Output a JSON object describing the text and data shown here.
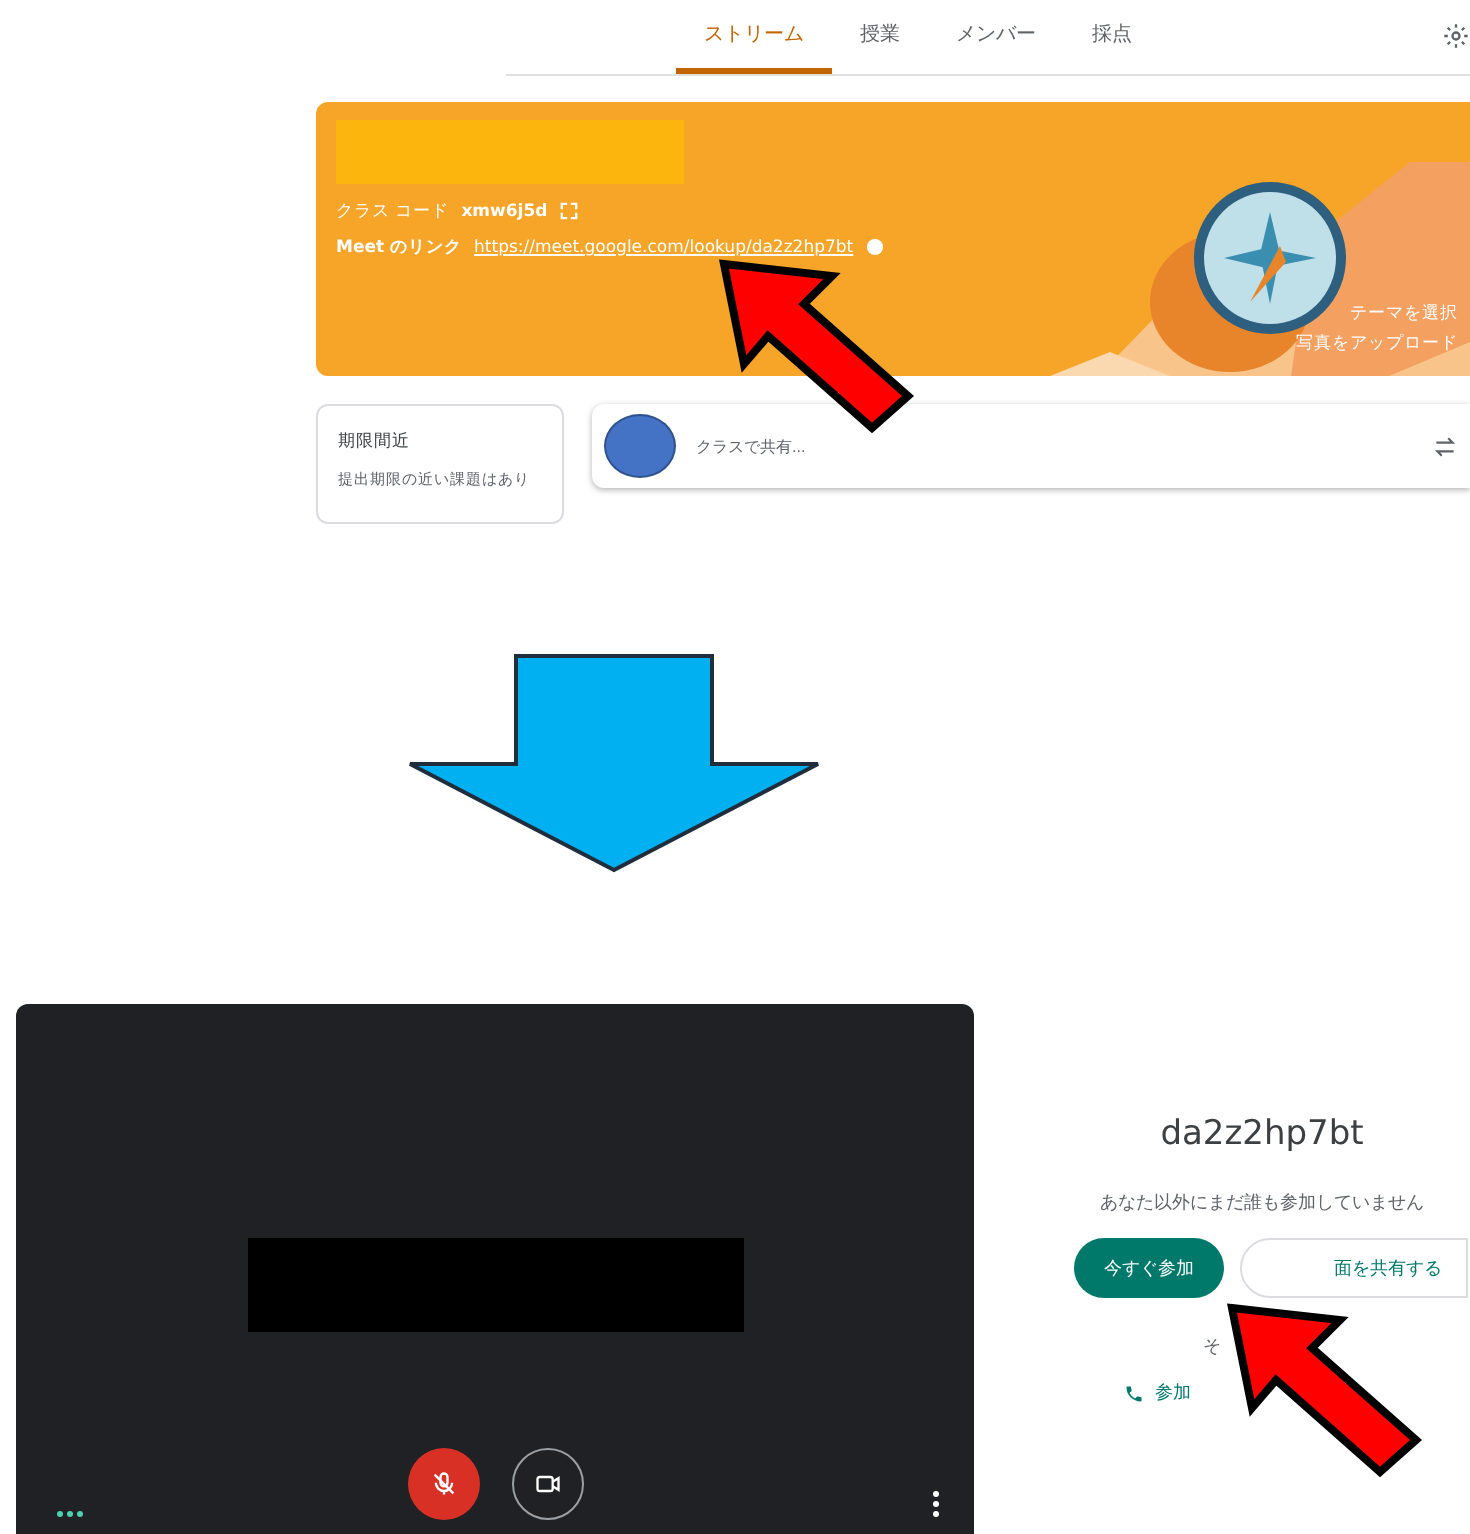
{
  "classroom": {
    "tabs": [
      {
        "label": "ストリーム",
        "selected": true
      },
      {
        "label": "授業",
        "selected": false
      },
      {
        "label": "メンバー",
        "selected": false
      },
      {
        "label": "採点",
        "selected": false
      }
    ],
    "banner": {
      "class_code_label": "クラス コード",
      "class_code": "xmw6j5d",
      "meet_label": "Meet のリンク",
      "meet_link": "https://meet.google.com/lookup/da2z2hp7bt",
      "theme_link": "テーマを選択",
      "upload_link": "写真をアップロード"
    },
    "upcoming": {
      "title": "期限間近",
      "text": "提出期限の近い課題はあり"
    },
    "share": {
      "placeholder": "クラスで共有..."
    }
  },
  "meet": {
    "meeting_code": "da2z2hp7bt",
    "status": "あなた以外にまだ誰も参加していません",
    "join_button": "今すぐ参加",
    "present_button": "面を共有する",
    "other_text": "そ",
    "phone_join": "参加",
    "mic_muted": true
  }
}
